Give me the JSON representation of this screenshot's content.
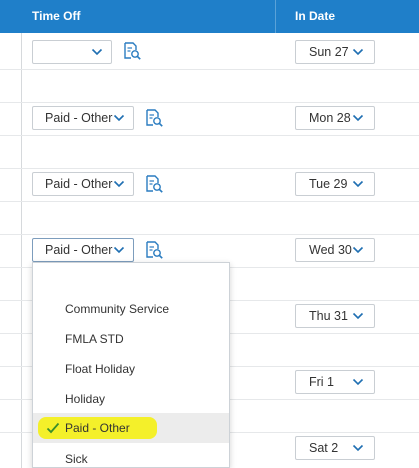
{
  "header": {
    "time_off": "Time Off",
    "in_date": "In Date"
  },
  "rows": [
    {
      "time_off_value": "",
      "date": "Sun 27"
    },
    {
      "time_off_value": "Paid - Other",
      "date": "Mon 28"
    },
    {
      "time_off_value": "Paid - Other",
      "date": "Tue 29"
    },
    {
      "time_off_value": "Paid - Other",
      "date": "Wed 30"
    },
    {
      "date": "Thu 31"
    },
    {
      "date": "Fri 1"
    },
    {
      "date": "Sat 2"
    }
  ],
  "dropdown": {
    "items": [
      "Community Service",
      "FMLA STD",
      "Float Holiday",
      "Holiday",
      "Paid - Other",
      "Sick"
    ],
    "selected": "Paid - Other"
  },
  "colors": {
    "header": "#1f7fc9",
    "accent": "#1f6fb2",
    "highlight": "#f4f02a",
    "check": "#3a8f2a"
  },
  "icons": {
    "chevron": "chevron-down-icon",
    "search": "search-document-icon",
    "check": "checkmark-icon"
  }
}
